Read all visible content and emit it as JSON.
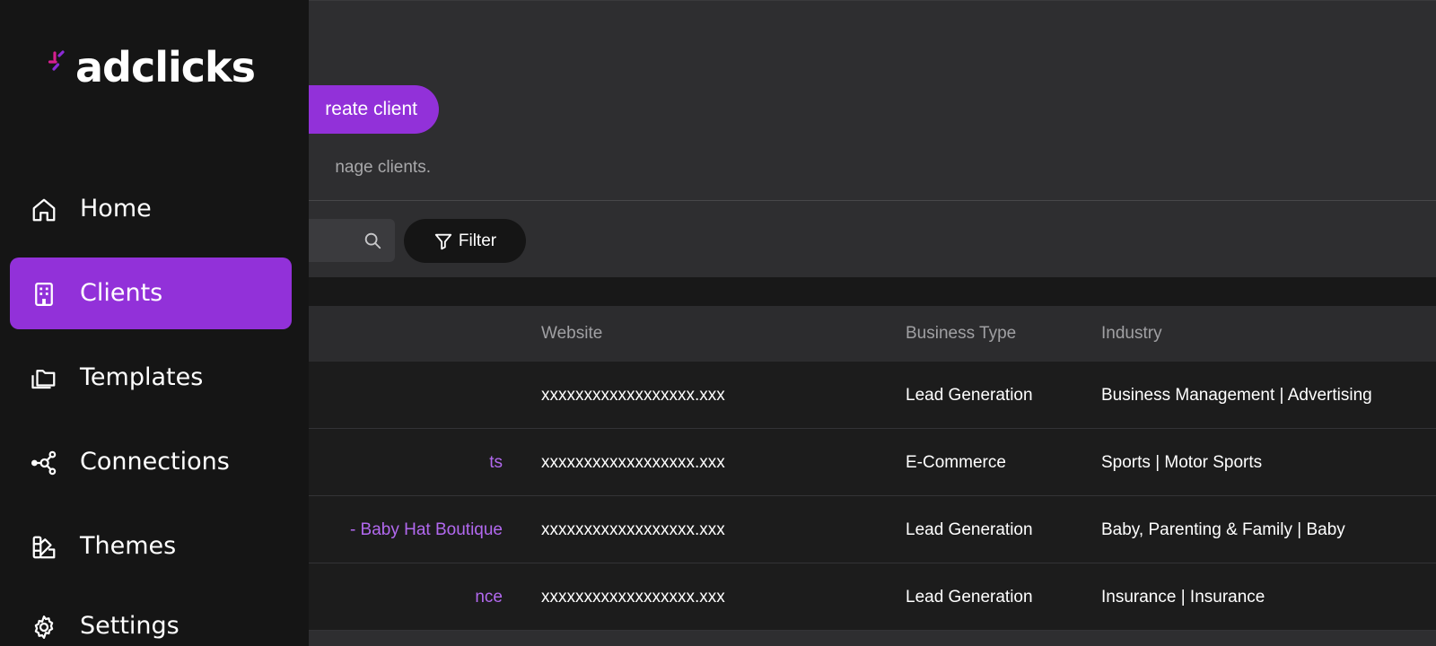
{
  "brand": {
    "name": "adclicks",
    "accent_color": "#9231d9",
    "logo_mark_colors": [
      "#d61f8f",
      "#8b2bd6"
    ]
  },
  "sidebar": {
    "items": [
      {
        "label": "Home",
        "icon": "home-icon",
        "active": false
      },
      {
        "label": "Clients",
        "icon": "building-icon",
        "active": true
      },
      {
        "label": "Templates",
        "icon": "folders-icon",
        "active": false
      },
      {
        "label": "Connections",
        "icon": "connections-icon",
        "active": false
      },
      {
        "label": "Themes",
        "icon": "themes-icon",
        "active": false
      },
      {
        "label": "Settings",
        "icon": "gear-icon",
        "active": false
      }
    ]
  },
  "header": {
    "create_button": "reate client",
    "subtitle": "nage clients."
  },
  "toolbar": {
    "search_placeholder": "",
    "filter_label": "Filter"
  },
  "table": {
    "columns": {
      "name": "",
      "website": "Website",
      "business_type": "Business Type",
      "industry": "Industry"
    },
    "rows": [
      {
        "name": "",
        "website": "xxxxxxxxxxxxxxxxxx.xxx",
        "business_type": "Lead Generation",
        "industry": "Business Management | Advertising"
      },
      {
        "name": "ts",
        "website": "xxxxxxxxxxxxxxxxxx.xxx",
        "business_type": "E-Commerce",
        "industry": "Sports | Motor Sports"
      },
      {
        "name": "- Baby Hat Boutique",
        "website": "xxxxxxxxxxxxxxxxxx.xxx",
        "business_type": "Lead Generation",
        "industry": "Baby, Parenting & Family | Baby"
      },
      {
        "name": "nce",
        "website": "xxxxxxxxxxxxxxxxxx.xxx",
        "business_type": "Lead Generation",
        "industry": "Insurance | Insurance"
      }
    ]
  }
}
